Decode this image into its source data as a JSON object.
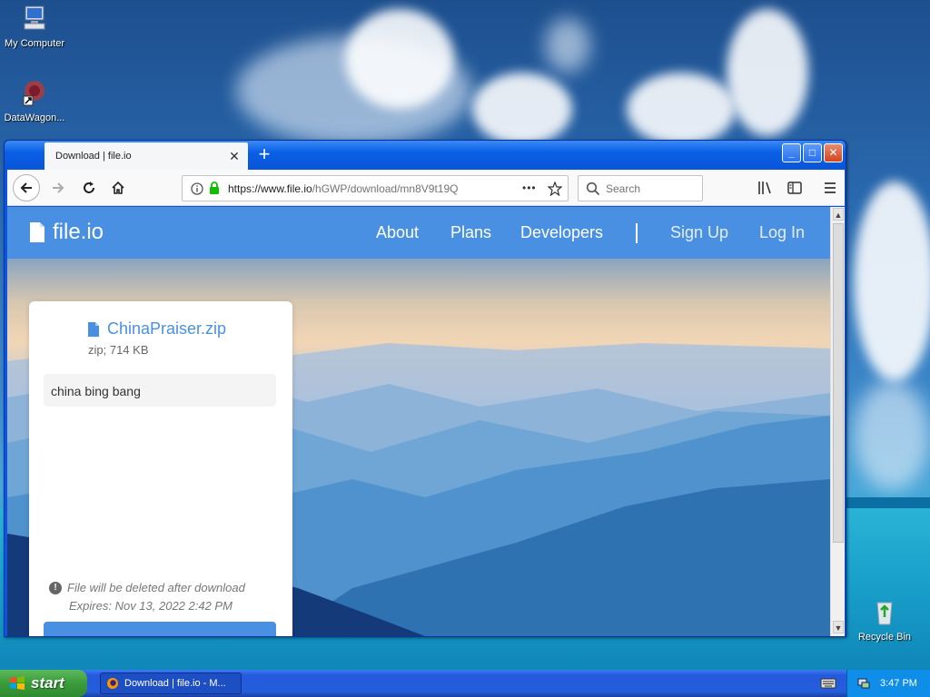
{
  "desktop": {
    "icons": [
      {
        "label": "My Computer",
        "icon": "computer-icon"
      },
      {
        "label": "DataWagon...",
        "icon": "datawagon-icon"
      },
      {
        "label": "Recycle Bin",
        "icon": "recycle-bin-icon"
      }
    ]
  },
  "browser": {
    "tab_title": "Download | file.io",
    "tab_close": "✕",
    "new_tab": "+",
    "window_buttons": {
      "minimize": "_",
      "maximize": "□",
      "close": "✕"
    },
    "url_host": "https://www.file.io",
    "url_path": "/hGWP/download/mn8V9t19Q",
    "url_menu": "•••",
    "search_placeholder": "Search"
  },
  "site": {
    "logo": "file.io",
    "nav": [
      "About",
      "Plans",
      "Developers",
      "Sign Up",
      "Log In"
    ],
    "file": {
      "name": "ChinaPraiser.zip",
      "meta": "zip; 714 KB",
      "description": "china bing bang",
      "notice": "File will be deleted after download",
      "expires": "Expires: Nov 13, 2022 2:42 PM"
    }
  },
  "taskbar": {
    "start": "start",
    "task": "Download | file.io - M...",
    "clock": "3:47 PM"
  },
  "colors": {
    "brand": "#4a90e2",
    "xp_title": "#0a5fe6",
    "start_green": "#3a9b3a"
  }
}
